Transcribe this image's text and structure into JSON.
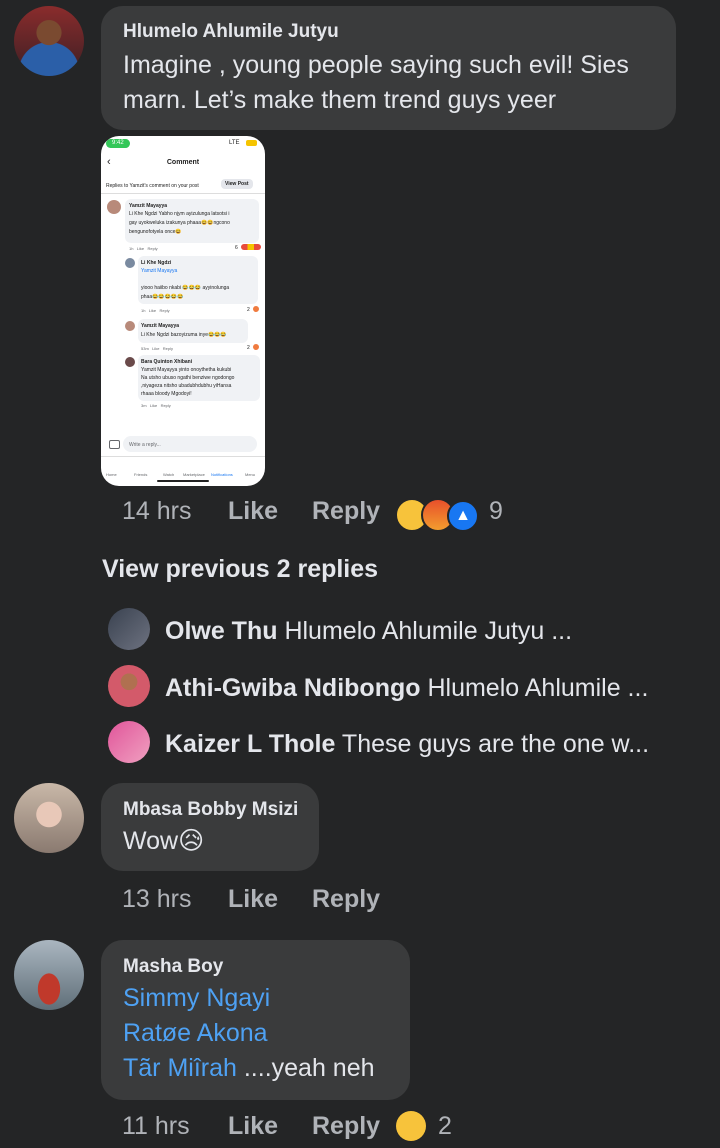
{
  "comment1": {
    "author": "Hlumelo Ahlumile Jutyu",
    "text_line1": "Imagine , young people saying such evil! Sies",
    "text_line2": "marn. Let’s make them trend guys yeer",
    "time": "14 hrs",
    "like": "Like",
    "reply": "Reply",
    "reaction_count": "9",
    "reactions": [
      "crying-face",
      "angry-face",
      "thumbs-up"
    ]
  },
  "screenshot": {
    "status_time": "9:42",
    "status_net": "LTE",
    "title": "Comment",
    "subheader": "Replies to Yamzit's comment on your post",
    "view_post": "View Post",
    "c1_author": "Yamzit Mayayya",
    "c1_l1": "Li Khe Ngdzi  Yabho njym ayizulunga latsotsi i",
    "c1_l2": "gay uyokweluka izakunya phaaa😆😆ngcono",
    "c1_l3": "bengunofotyela once😆",
    "c1_meta": "1h   Like   Reply",
    "c1_count": "6",
    "c2_author": "Li Khe Ngdzi",
    "c2_l1": "Yamzit Mayayya",
    "c2_l2": "yiooo haiibo nkabi 😂😂😂 ayyinolunga",
    "c2_l3": "phaa😂😂😂😂😂",
    "c2_meta": "1h   Like   Reply",
    "c2_count": "2",
    "c3_author": "Yamzit Mayayya",
    "c3_l1": "Li Khe Ngdzi  bazoyizuma inye😂😂😂",
    "c3_meta": "53m   Like   Reply",
    "c3_count": "2",
    "c4_author": "Bara Quinton Xhibani",
    "c4_l1": "Yamzit Mayayya yinto onoythetha kukubi",
    "c4_l2": "Na utsho ubuso ngathi benziwe ngodongo",
    "c4_l3": ",niyageza nitsho ubadubhdubhu yiHansa",
    "c4_l4": "rhaaa bloody Mgodoyi!",
    "c4_meta": "3m   Like   Reply",
    "input_placeholder": "Write a reply...",
    "nav": [
      "Home",
      "Friends",
      "Watch",
      "Marketplace",
      "Notifications",
      "Menu"
    ]
  },
  "view_previous": "View previous 2 replies",
  "replies": [
    {
      "name": "Olwe Thu",
      "text": "Hlumelo Ahlumile Jutyu ..."
    },
    {
      "name": "Athi-Gwiba Ndibongo",
      "text": "Hlumelo Ahlumile ..."
    },
    {
      "name": "Kaizer L Thole",
      "text": "These guys are the one w..."
    }
  ],
  "comment2": {
    "author": "Mbasa Bobby Msizi",
    "text": "Wow😥",
    "time": "13 hrs",
    "like": "Like",
    "reply": "Reply"
  },
  "comment3": {
    "author": "Masha Boy",
    "tag1": "Simmy Ngayi",
    "tag2": "Ratøe Akona",
    "tag3": "Tãr Miîrah",
    "tail": " ....yeah neh",
    "time": "11 hrs",
    "like": "Like",
    "reply": "Reply",
    "reaction_count": "2",
    "reactions": [
      "crying-face"
    ]
  },
  "colors": {
    "background": "#242526",
    "bubble": "#3a3b3c",
    "link": "#4ea1f3",
    "secondary_text": "#b0b3b8",
    "like_blue": "#1877f2"
  }
}
